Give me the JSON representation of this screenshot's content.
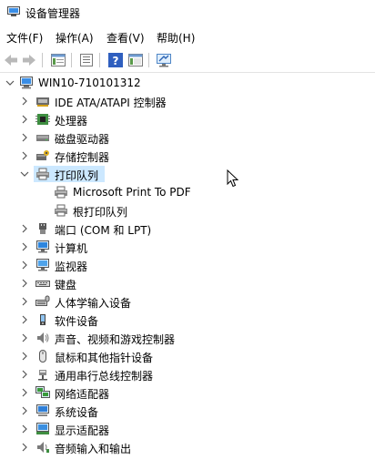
{
  "window": {
    "title": "设备管理器"
  },
  "menu": [
    "文件(F)",
    "操作(A)",
    "查看(V)",
    "帮助(H)"
  ],
  "toolbar": [
    "back-arrow-icon",
    "forward-arrow-icon",
    "properties-icon",
    "list-icon",
    "help-icon",
    "panel-icon",
    "monitor-scan-icon"
  ],
  "root": {
    "label": "WIN10-710101312"
  },
  "categories": [
    {
      "label": "IDE ATA/ATAPI 控制器",
      "icon": "ide-controller-icon"
    },
    {
      "label": "处理器",
      "icon": "processor-icon"
    },
    {
      "label": "磁盘驱动器",
      "icon": "disk-drive-icon"
    },
    {
      "label": "存储控制器",
      "icon": "storage-controller-icon"
    },
    {
      "label": "打印队列",
      "icon": "printer-icon",
      "expanded": true,
      "children": [
        {
          "label": "Microsoft Print To PDF",
          "icon": "printer-icon"
        },
        {
          "label": "根打印队列",
          "icon": "printer-icon"
        }
      ]
    },
    {
      "label": "端口 (COM 和 LPT)",
      "icon": "port-icon"
    },
    {
      "label": "计算机",
      "icon": "computer-icon"
    },
    {
      "label": "监视器",
      "icon": "monitor-icon"
    },
    {
      "label": "键盘",
      "icon": "keyboard-icon"
    },
    {
      "label": "人体学输入设备",
      "icon": "hid-icon"
    },
    {
      "label": "软件设备",
      "icon": "software-device-icon"
    },
    {
      "label": "声音、视频和游戏控制器",
      "icon": "sound-icon"
    },
    {
      "label": "鼠标和其他指针设备",
      "icon": "mouse-icon"
    },
    {
      "label": "通用串行总线控制器",
      "icon": "usb-icon"
    },
    {
      "label": "网络适配器",
      "icon": "network-adapter-icon"
    },
    {
      "label": "系统设备",
      "icon": "system-device-icon"
    },
    {
      "label": "显示适配器",
      "icon": "display-adapter-icon"
    },
    {
      "label": "音频输入和输出",
      "icon": "audio-io-icon"
    }
  ],
  "colors": {
    "selection": "#cce8ff",
    "accent": "#0078d7"
  }
}
